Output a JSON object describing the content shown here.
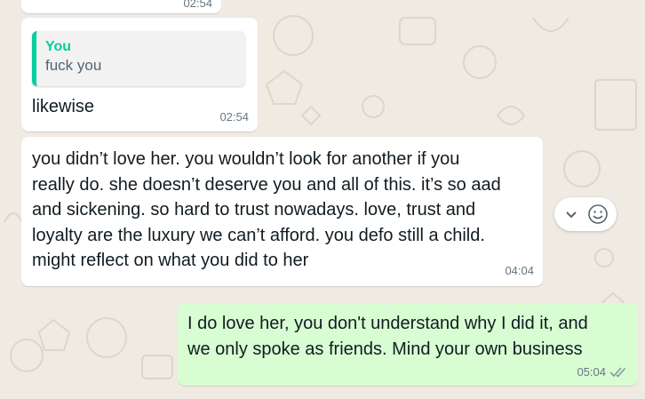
{
  "chat": {
    "top_message": {
      "time": "02:54"
    },
    "reply_message": {
      "quote_author": "You",
      "quote_text": "fuck you",
      "text": "likewise",
      "time": "02:54"
    },
    "long_message": {
      "lines": [
        "you didn’t love her. you wouldn’t look for another if you",
        "really do. she doesn’t deserve you and all of this. it’s so aad",
        "and sickening. so hard to trust nowadays. love, trust and",
        "loyalty are the luxury we can’t afford. you defo still a child.",
        "might reflect on what you did to her"
      ],
      "time": "04:04"
    },
    "outgoing_message": {
      "lines": [
        "I do love her, you don't understand why I did it, and",
        "we only spoke as friends. Mind your own business"
      ],
      "time": "05:04",
      "status_icon": "double-check-icon"
    }
  },
  "actions": {
    "dropdown_icon": "chevron-down-icon",
    "emoji_icon": "emoji-icon"
  },
  "colors": {
    "background": "#efeae2",
    "incoming_bubble": "#ffffff",
    "outgoing_bubble": "#d9fdd3",
    "quote_accent": "#06cf9c",
    "meta_text": "#667781"
  }
}
